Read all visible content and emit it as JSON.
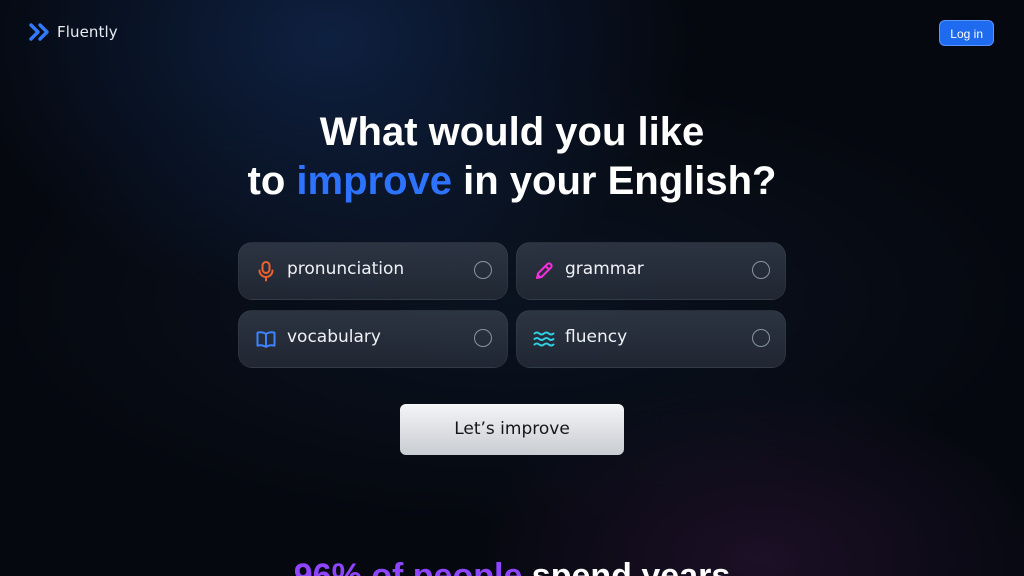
{
  "header": {
    "brand": "Fluently",
    "login_label": "Log in"
  },
  "hero": {
    "title_line1": "What would you like",
    "title_line2_pre": "to ",
    "title_line2_accent": "improve",
    "title_line2_post": " in your English?",
    "accent_color": "#2d73ff"
  },
  "options": [
    {
      "label": "pronunciation",
      "icon": "microphone-icon",
      "icon_color": "#f0612e",
      "selected": false
    },
    {
      "label": "grammar",
      "icon": "pencil-icon",
      "icon_color": "#f22fd8",
      "selected": false
    },
    {
      "label": "vocabulary",
      "icon": "book-icon",
      "icon_color": "#3d82ff",
      "selected": false
    },
    {
      "label": "fluency",
      "icon": "waves-icon",
      "icon_color": "#2fd1e4",
      "selected": false
    }
  ],
  "cta": {
    "label": "Let’s improve"
  },
  "subhead": {
    "accent": "96% of people",
    "rest": " spend years",
    "accent_color": "#8f45ff"
  }
}
